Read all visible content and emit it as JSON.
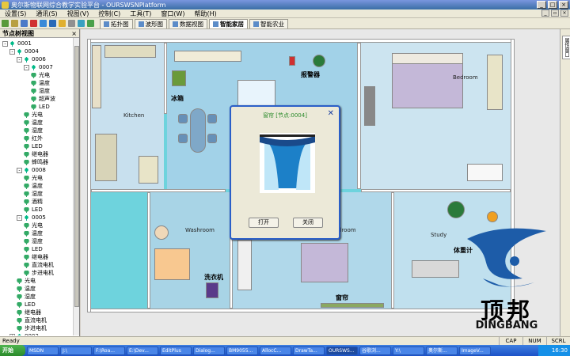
{
  "window": {
    "title": "奥尔斯物联网综合教学实验平台 - OURSWSNPlatform"
  },
  "menu": {
    "items": [
      "设置(S)",
      "通讯(S)",
      "视图(V)",
      "控制(C)",
      "工具(T)",
      "窗口(W)",
      "帮助(H)"
    ]
  },
  "tabs": [
    {
      "label": "拓扑图"
    },
    {
      "label": "波形图"
    },
    {
      "label": "数据视图"
    },
    {
      "label": "智能家居"
    },
    {
      "label": "智能农业"
    }
  ],
  "left_panel": {
    "title": "节点树视图",
    "close": "×"
  },
  "tree": [
    {
      "label": "0001",
      "level": 0,
      "type": "ant",
      "exp": "-"
    },
    {
      "label": "0004",
      "level": 1,
      "type": "ant",
      "exp": "-"
    },
    {
      "label": "0006",
      "level": 2,
      "type": "ant",
      "exp": "-"
    },
    {
      "label": "0007",
      "level": 3,
      "type": "ant",
      "exp": "-"
    },
    {
      "label": "光电",
      "level": 4,
      "type": "sen"
    },
    {
      "label": "温度",
      "level": 4,
      "type": "sen"
    },
    {
      "label": "湿度",
      "level": 4,
      "type": "sen"
    },
    {
      "label": "超声波",
      "level": 4,
      "type": "sen"
    },
    {
      "label": "LED",
      "level": 4,
      "type": "sen"
    },
    {
      "label": "光电",
      "level": 3,
      "type": "sen"
    },
    {
      "label": "温度",
      "level": 3,
      "type": "sen"
    },
    {
      "label": "湿度",
      "level": 3,
      "type": "sen"
    },
    {
      "label": "红外",
      "level": 3,
      "type": "sen"
    },
    {
      "label": "LED",
      "level": 3,
      "type": "sen"
    },
    {
      "label": "继电器",
      "level": 3,
      "type": "sen"
    },
    {
      "label": "蜂鸣器",
      "level": 3,
      "type": "sen"
    },
    {
      "label": "0008",
      "level": 2,
      "type": "ant",
      "exp": "-"
    },
    {
      "label": "光电",
      "level": 3,
      "type": "sen"
    },
    {
      "label": "温度",
      "level": 3,
      "type": "sen"
    },
    {
      "label": "湿度",
      "level": 3,
      "type": "sen"
    },
    {
      "label": "酒精",
      "level": 3,
      "type": "sen"
    },
    {
      "label": "LED",
      "level": 3,
      "type": "sen"
    },
    {
      "label": "0005",
      "level": 2,
      "type": "ant",
      "exp": "-"
    },
    {
      "label": "光电",
      "level": 3,
      "type": "sen"
    },
    {
      "label": "温度",
      "level": 3,
      "type": "sen"
    },
    {
      "label": "湿度",
      "level": 3,
      "type": "sen"
    },
    {
      "label": "LED",
      "level": 3,
      "type": "sen"
    },
    {
      "label": "继电器",
      "level": 3,
      "type": "sen"
    },
    {
      "label": "直流电机",
      "level": 3,
      "type": "sen"
    },
    {
      "label": "步进电机",
      "level": 3,
      "type": "sen"
    },
    {
      "label": "光电",
      "level": 2,
      "type": "sen"
    },
    {
      "label": "温度",
      "level": 2,
      "type": "sen"
    },
    {
      "label": "湿度",
      "level": 2,
      "type": "sen"
    },
    {
      "label": "LED",
      "level": 2,
      "type": "sen"
    },
    {
      "label": "继电器",
      "level": 2,
      "type": "sen"
    },
    {
      "label": "直流电机",
      "level": 2,
      "type": "sen"
    },
    {
      "label": "步进电机",
      "level": 2,
      "type": "sen"
    },
    {
      "label": "0003",
      "level": 1,
      "type": "ant",
      "exp": "+"
    }
  ],
  "plan_labels": {
    "kitchen": "Kitchen",
    "fridge": "冰箱",
    "alarm": "报警器",
    "bedroom1": "Bedroom",
    "washroom": "Washroom",
    "washer": "洗衣机",
    "bedroom2": "droom",
    "study": "Study",
    "scale": "体重计",
    "curtain": "窗帘"
  },
  "dialog": {
    "title": "窗帘 [节点:0004]",
    "close": "✕",
    "open_btn": "打开",
    "close_btn": "关闭"
  },
  "right_strip": {
    "label": "属性窗口"
  },
  "logo": {
    "cn": "顶邦",
    "en": "DINGBANG"
  },
  "status": {
    "text": "Ready",
    "caps": "CAP",
    "num": "NUM",
    "scrl": "SCRL"
  },
  "taskbar": {
    "start": "开始",
    "items": [
      "MSDN",
      "J:\\",
      "F:\\Roa...",
      "E:\\Dev...",
      "EditPlus",
      "Dialog...",
      "BM9055...",
      "AllocC...",
      "DrawTa...",
      "OURSWS...",
      "谷歌浏...",
      "Y:\\",
      "奥尔斯...",
      "ImageV..."
    ],
    "clock": "16:30"
  },
  "colors": {
    "accent": "#2b5fc8",
    "floor": "#6ed3dd"
  }
}
